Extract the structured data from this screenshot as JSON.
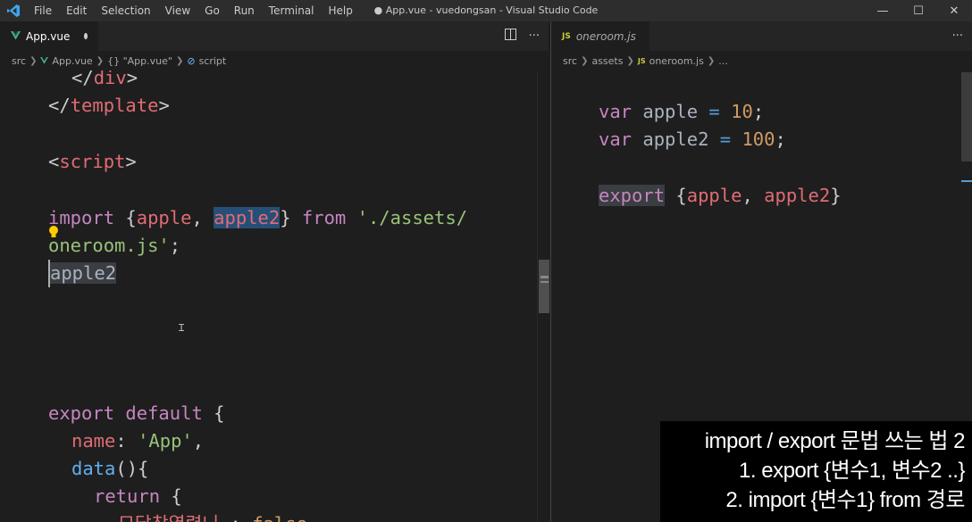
{
  "titlebar": {
    "menu": [
      "File",
      "Edit",
      "Selection",
      "View",
      "Go",
      "Run",
      "Terminal",
      "Help"
    ],
    "window_title": "● App.vue - vuedongsan - Visual Studio Code",
    "controls": {
      "minimize": "—",
      "maximize": "☐",
      "close": "✕"
    }
  },
  "left_editor": {
    "tab_label": "App.vue",
    "breadcrumb": [
      "src",
      "App.vue",
      "{} \"App.vue\"",
      "script"
    ],
    "split_icon": "split-editor-icon",
    "more_icon": "more-actions-icon"
  },
  "right_editor": {
    "tab_label": "oneroom.js",
    "tab_prefix": "JS",
    "breadcrumb": [
      "src",
      "assets",
      "oneroom.js",
      "..."
    ],
    "more_icon": "more-actions-icon"
  },
  "left_code": {
    "l1": {
      "a": "</",
      "b": "div",
      "c": ">"
    },
    "l2": {
      "a": "</",
      "b": "template",
      "c": ">"
    },
    "l4": {
      "a": "<",
      "b": "script",
      "c": ">"
    },
    "l6": {
      "import": "import",
      "open": " {",
      "apple": "apple",
      "comma": ", ",
      "apple2": "apple2",
      "close": "} ",
      "from": "from",
      "str": " './assets/"
    },
    "l7": {
      "str": "oneroom.js'",
      "semi": ";"
    },
    "l8": {
      "text": "apple2"
    },
    "l13": {
      "export": "export",
      "default": " default",
      "brace": " {"
    },
    "l14": {
      "key": "name",
      "colon": ": ",
      "val": "'App'",
      "comma": ","
    },
    "l15": {
      "fn": "data",
      "rest": "(){"
    },
    "l16": {
      "ret": "return",
      "brace": " {"
    },
    "l17": {
      "key": "모달창열렸니",
      "colon": " : ",
      "val": "false"
    }
  },
  "right_code": {
    "l1": {
      "var": "var",
      "name": " apple",
      "eq": " = ",
      "num": "10",
      "semi": ";"
    },
    "l2": {
      "var": "var",
      "name": " apple2",
      "eq": " = ",
      "num": "100",
      "semi": ";"
    },
    "l4": {
      "export": "export",
      "open": " {",
      "a": "apple",
      "comma": ", ",
      "b": "apple2",
      "close": "}"
    }
  },
  "caption": {
    "line1": "import / export 문법 쓰는 법 2",
    "line2": "1. export {변수1, 변수2 ..}",
    "line3": "2. import {변수1} from 경로"
  },
  "colors": {
    "keyword": "#c586c0",
    "string": "#98c379",
    "number": "#d19a66",
    "variable": "#e06c75",
    "tag": "#569cd6"
  }
}
